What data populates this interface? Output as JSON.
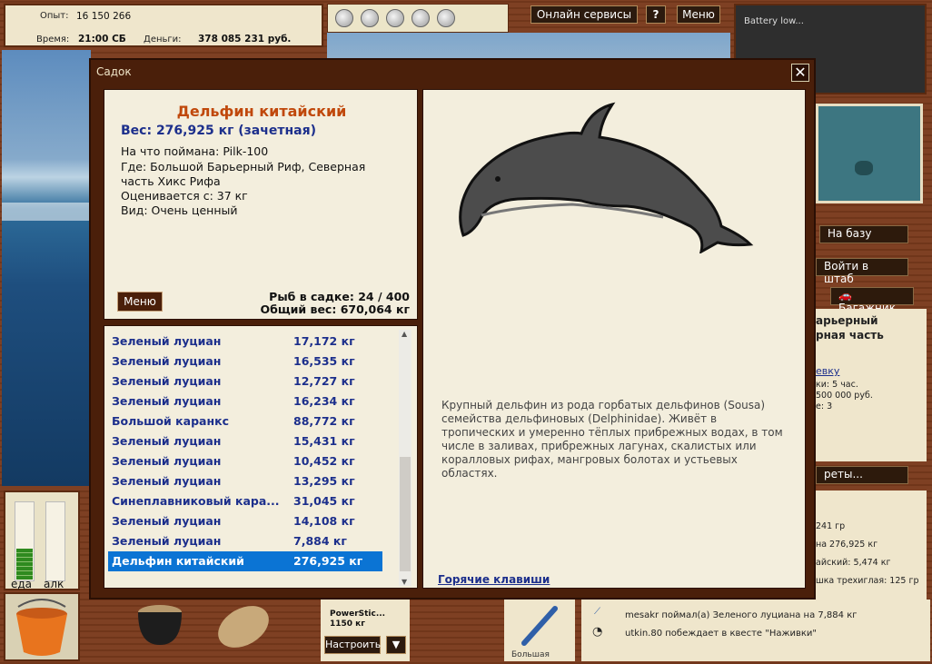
{
  "stats": {
    "exp_label": "Опыт:",
    "exp_value": "16 150 266",
    "time_label": "Время:",
    "time_value": "21:00 СБ",
    "money_label": "Деньги:",
    "money_value": "378 085 231 руб."
  },
  "top_buttons": {
    "online": "Онлайн сервисы",
    "help": "?",
    "menu": "Меню"
  },
  "battery": "Battery low...",
  "right_panel": {
    "to_base": "На базу",
    "enter_hq": "Войти в штаб",
    "trunk": "Багажник",
    "loc_line1": "арьерный",
    "loc_line2": "рная часть",
    "link": "евку",
    "line_a": "ки: 5 час.",
    "line_b": "500 000 руб.",
    "line_c": "е: 3",
    "secrets": "реты...",
    "feed1": "241 гр",
    "feed2": "на 276,925 кг",
    "feed3": "айский: 5,474 кг",
    "feed4": "шка трехиглая: 125 гр"
  },
  "meters": {
    "food": "еда",
    "alc": "алк"
  },
  "bottom": {
    "rod_name": "PowerStic...",
    "rod_weight": "1150 кг",
    "setup": "Настроить",
    "lure_label": "Большая",
    "feed_line1": "mesakr поймал(а) Зеленого луциана на 7,884 кг",
    "feed_line2": "utkin.80 побеждает в квесте \"Наживки\""
  },
  "modal": {
    "title": "Садок",
    "close": "✕",
    "fish_name": "Дельфин китайский",
    "weight": "Вес: 276,925 кг (зачетная)",
    "caught_on": "На что поймана: Pilk-100",
    "where_1": "Где: Большой Барьерный Риф, Северная",
    "where_2": "часть Хикс Рифа",
    "rated_from": "Оценивается с: 37 кг",
    "kind": "Вид: Очень ценный",
    "menu": "Меню",
    "fish_count": "Рыб в садке: 24 / 400",
    "total_weight": "Общий вес: 670,064 кг",
    "description": "Крупный дельфин из рода горбатых дельфинов (Sousa) семейства дельфиновых (Delphinidae). Живёт в тропических и умеренно тёплых прибрежных водах, в том числе в заливах, прибрежных лагунах, скалистых или коралловых рифах, мангровых болотах и устьевых областях.",
    "hotkeys": "Горячие клавиши",
    "list": [
      {
        "name": "Зеленый луциан",
        "weight": "17,172 кг"
      },
      {
        "name": "Зеленый луциан",
        "weight": "16,535 кг"
      },
      {
        "name": "Зеленый луциан",
        "weight": "12,727 кг"
      },
      {
        "name": "Зеленый луциан",
        "weight": "16,234 кг"
      },
      {
        "name": "Большой каранкс",
        "weight": "88,772 кг"
      },
      {
        "name": "Зеленый луциан",
        "weight": "15,431 кг"
      },
      {
        "name": "Зеленый луциан",
        "weight": "10,452 кг"
      },
      {
        "name": "Зеленый луциан",
        "weight": "13,295 кг"
      },
      {
        "name": "Синеплавниковый кара...",
        "weight": "31,045 кг"
      },
      {
        "name": "Зеленый луциан",
        "weight": "14,108 кг"
      },
      {
        "name": "Зеленый луциан",
        "weight": "7,884 кг"
      },
      {
        "name": "Дельфин китайский",
        "weight": "276,925 кг"
      }
    ]
  },
  "colors": {
    "title_orange": "#c0480b",
    "list_blue": "#1c2f8c",
    "selection": "#0b74d4",
    "wood": "#7a3a1c"
  },
  "icons": [
    "bait-icon",
    "close-icon",
    "car-icon",
    "bucket-icon",
    "cauldron-icon",
    "net-bag-icon",
    "lure-icon",
    "clock-icon",
    "help-icon",
    "dropdown-arrow-icon"
  ]
}
